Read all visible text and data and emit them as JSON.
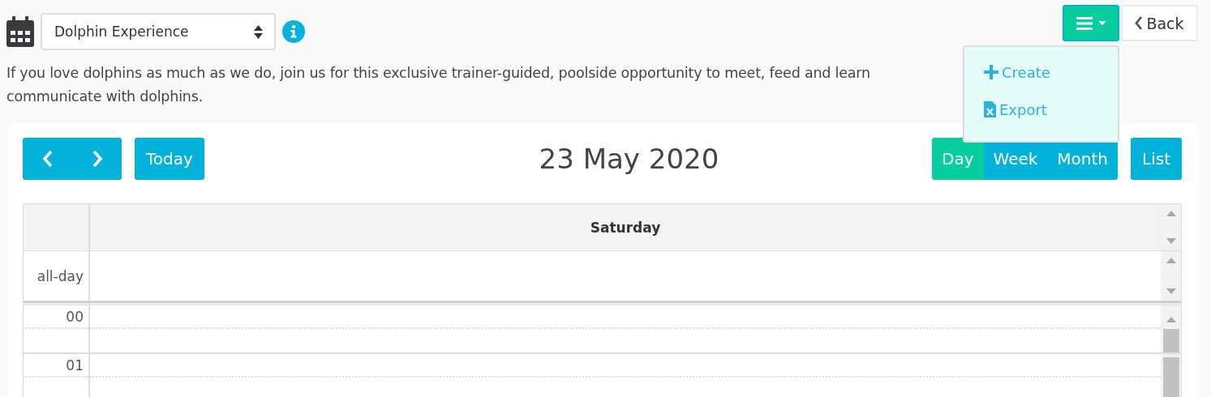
{
  "header": {
    "calendar_select": {
      "value": "Dolphin Experience"
    },
    "menu": {
      "expanded": true,
      "items": [
        {
          "kind": "create",
          "label": "Create"
        },
        {
          "kind": "export",
          "label": "Export"
        }
      ]
    },
    "back": "Back"
  },
  "description": [
    "If you love dolphins as much as we do, join us for this exclusive trainer-guided, poolside opportunity to meet, feed and learn",
    "communicate with dolphins."
  ],
  "toolbar": {
    "today": "Today",
    "title": "23 May 2020",
    "views": [
      {
        "label": "Day",
        "selected": true
      },
      {
        "label": "Week",
        "selected": false
      },
      {
        "label": "Month",
        "selected": false
      }
    ],
    "list": {
      "label": "List",
      "selected": false
    }
  },
  "grid": {
    "day_header": "Saturday",
    "all_day_label": "all-day",
    "hours": [
      "00",
      "01"
    ]
  }
}
